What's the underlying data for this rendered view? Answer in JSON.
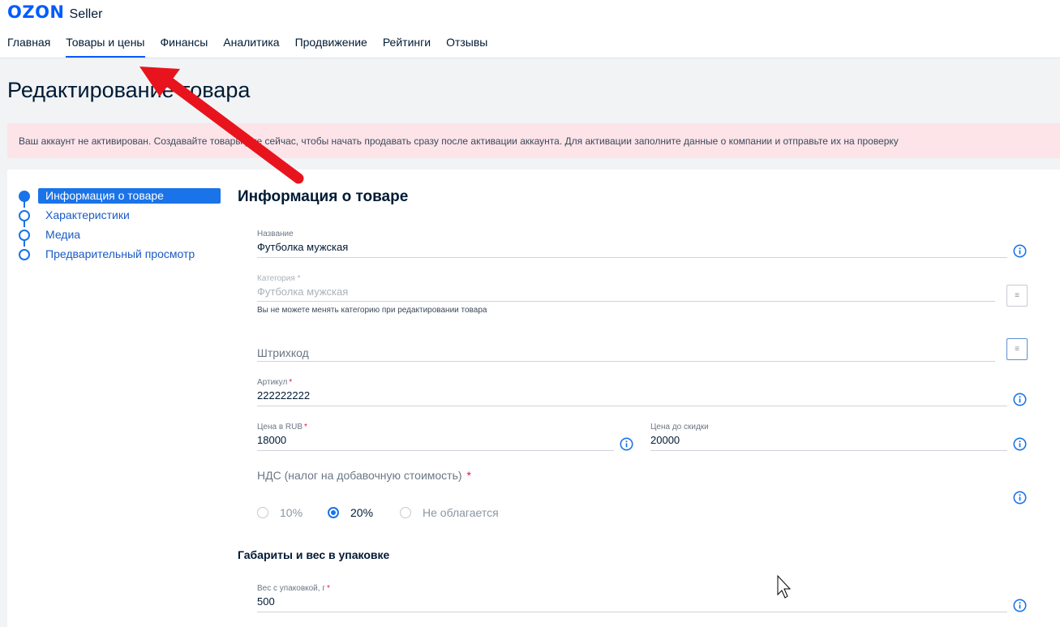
{
  "header": {
    "logo_brand": "OZON",
    "logo_product": "Seller",
    "nav": [
      {
        "label": "Главная"
      },
      {
        "label": "Товары и цены",
        "active": true
      },
      {
        "label": "Финансы"
      },
      {
        "label": "Аналитика"
      },
      {
        "label": "Продвижение"
      },
      {
        "label": "Рейтинги"
      },
      {
        "label": "Отзывы"
      }
    ]
  },
  "page": {
    "title": "Редактирование товара",
    "alert": "Ваш аккаунт не активирован. Создавайте товары уже сейчас, чтобы начать продавать сразу после активации аккаунта. Для активации заполните данные о компании и отправьте их на проверку"
  },
  "stepper": {
    "steps": [
      {
        "label": "Информация о товаре",
        "active": true
      },
      {
        "label": "Характеристики"
      },
      {
        "label": "Медиа"
      },
      {
        "label": "Предварительный просмотр"
      }
    ]
  },
  "form": {
    "section_title": "Информация о товаре",
    "name": {
      "label": "Название",
      "value": "Футболка мужская"
    },
    "category": {
      "label": "Категория",
      "required_mark": "*",
      "value": "Футболка мужская",
      "hint": "Вы не можете менять категорию при редактировании товара"
    },
    "barcode": {
      "placeholder": "Штрихкод"
    },
    "article": {
      "label": "Артикул",
      "required_mark": "*",
      "value": "222222222"
    },
    "price": {
      "label": "Цена в RUB",
      "required_mark": "*",
      "value": "18000"
    },
    "old_price": {
      "label": "Цена до скидки",
      "value": "20000"
    },
    "vat": {
      "label": "НДС (налог на добавочную стоимость)",
      "required_mark": "*",
      "options": [
        {
          "label": "10%",
          "checked": false
        },
        {
          "label": "20%",
          "checked": true
        },
        {
          "label": "Не облагается",
          "checked": false
        }
      ]
    },
    "dimensions_title": "Габариты и вес в упаковке",
    "weight": {
      "label": "Вес с упаковкой, г",
      "required_mark": "*",
      "value": "500"
    }
  },
  "colors": {
    "brand": "#005bff",
    "accent": "#1a73e8",
    "alert_bg": "#fce4e8",
    "required": "#e3163a",
    "arrow": "#e8141d"
  },
  "icons": {
    "info": "info-circle-icon",
    "list": "list-icon",
    "cursor": "mouse-cursor-icon",
    "annotation": "red-arrow-icon"
  }
}
